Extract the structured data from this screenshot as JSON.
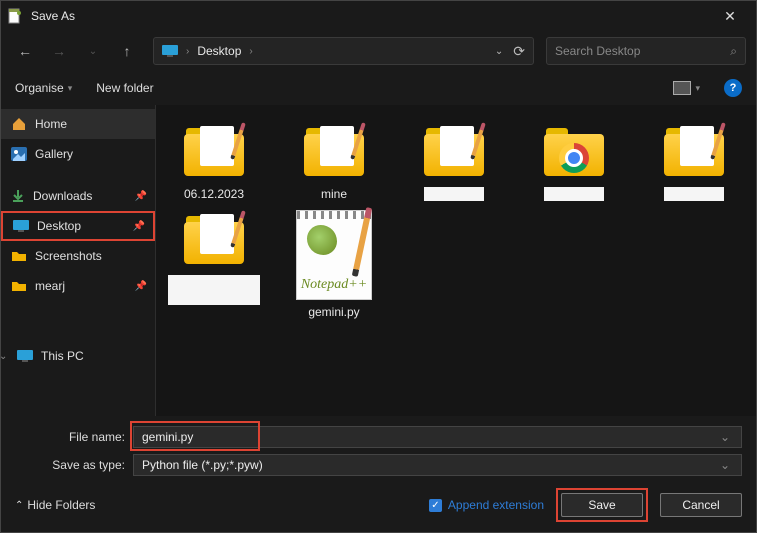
{
  "window": {
    "title": "Save As"
  },
  "nav": {
    "breadcrumb": [
      "Desktop"
    ],
    "search_placeholder": "Search Desktop"
  },
  "toolbar": {
    "organise": "Organise",
    "new_folder": "New folder"
  },
  "sidebar": {
    "home": "Home",
    "gallery": "Gallery",
    "downloads": "Downloads",
    "desktop": "Desktop",
    "screenshots": "Screenshots",
    "mearj": "mearj",
    "this_pc": "This PC"
  },
  "files": {
    "folder1": "06.12.2023",
    "folder2": "mine",
    "folder3": "",
    "folder4": "",
    "folder5": "",
    "folder6": "",
    "gemini": "gemini.py",
    "npp_text": "Notepad++"
  },
  "form": {
    "file_name_label": "File name:",
    "file_name_value": "gemini.py",
    "save_type_label": "Save as type:",
    "save_type_value": "Python file (*.py;*.pyw)"
  },
  "footer": {
    "hide_folders": "Hide Folders",
    "append_ext": "Append extension",
    "save": "Save",
    "cancel": "Cancel"
  }
}
